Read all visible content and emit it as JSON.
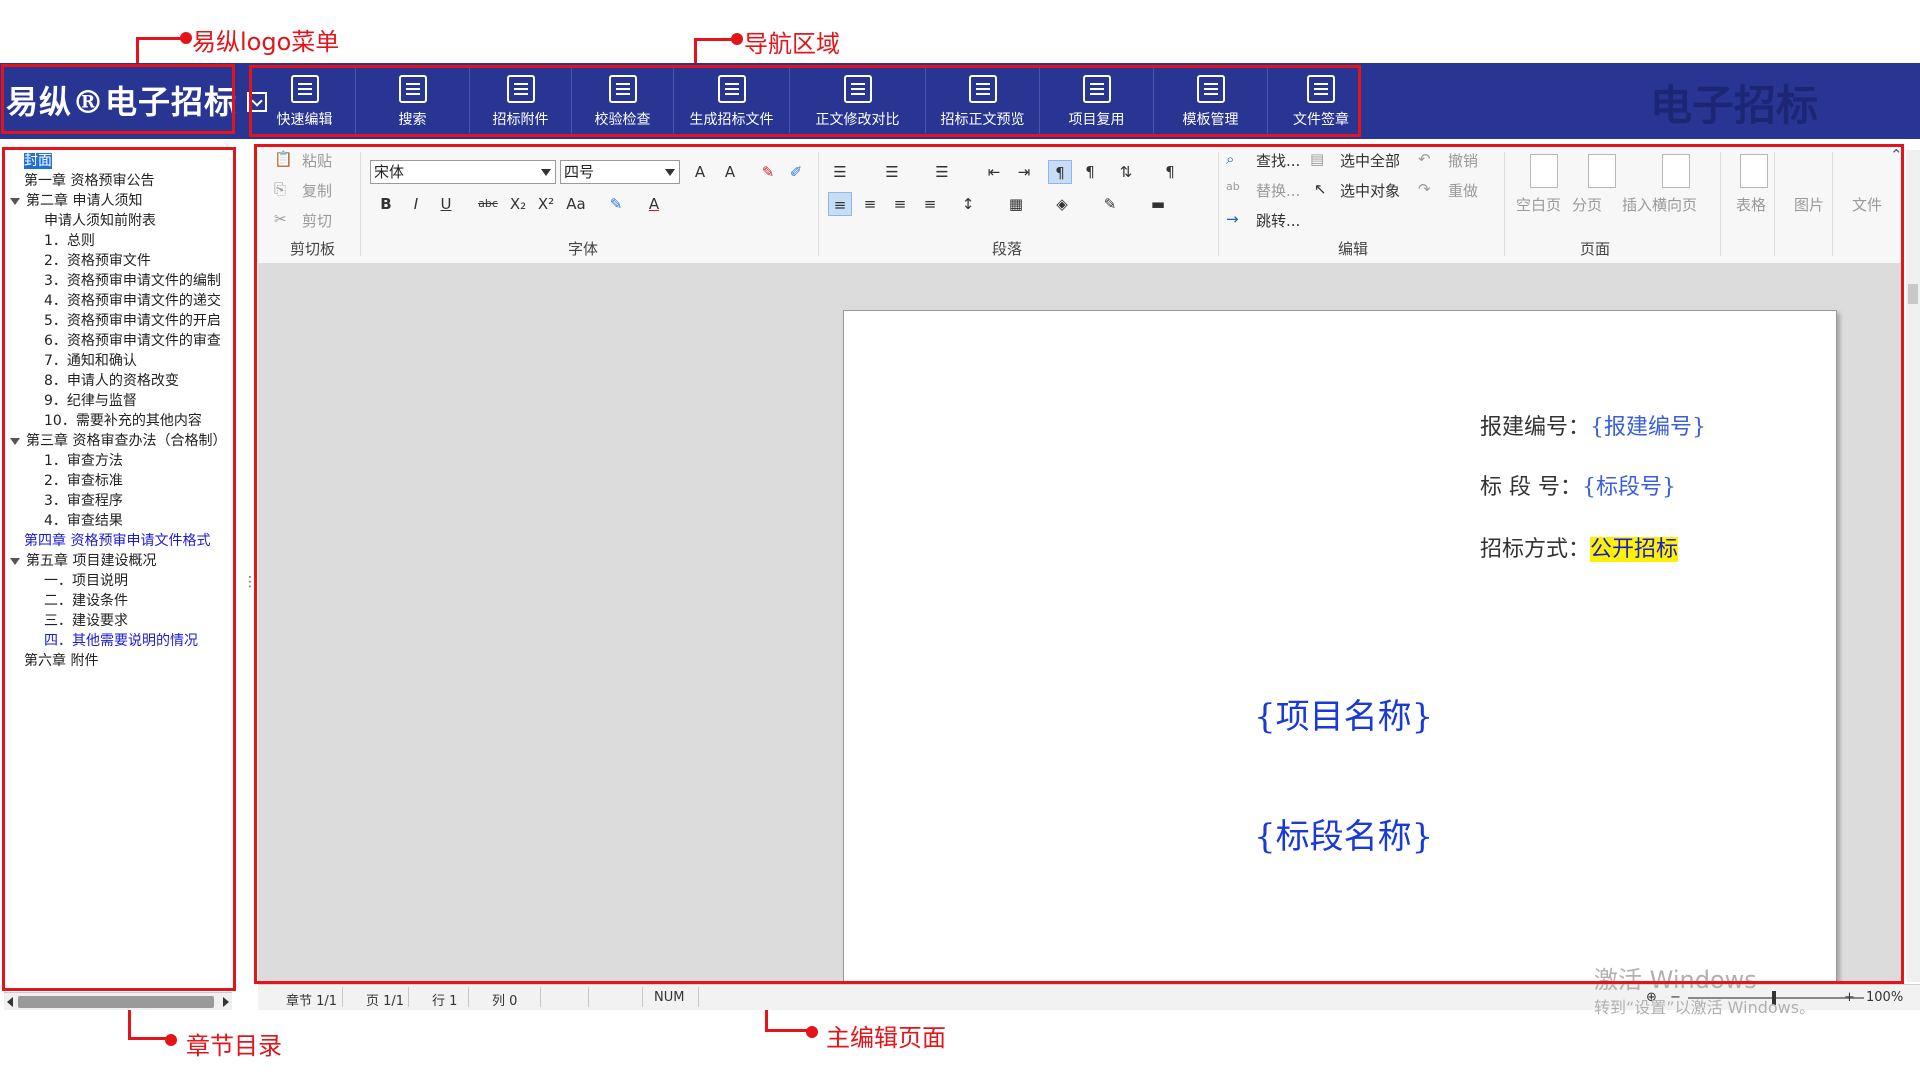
{
  "callouts": {
    "logo_menu": "易纵logo菜单",
    "nav_area": "导航区域",
    "chapter_toc": "章节目录",
    "main_editor": "主编辑页面"
  },
  "header": {
    "brand": "易纵®电子招标",
    "watermark": "电子招标",
    "nav": [
      "快速编辑",
      "搜索",
      "招标附件",
      "校验检查",
      "生成招标文件",
      "正文修改对比",
      "招标正文预览",
      "项目复用",
      "模板管理",
      "文件签章"
    ]
  },
  "toc": {
    "items": [
      {
        "text": "封面",
        "level": 1,
        "selected": true
      },
      {
        "text": "第一章 资格预审公告",
        "level": 1
      },
      {
        "text": "第二章 申请人须知",
        "level": 0
      },
      {
        "text": "申请人须知前附表",
        "level": 2
      },
      {
        "text": "1．总则",
        "level": 2
      },
      {
        "text": "2．资格预审文件",
        "level": 2
      },
      {
        "text": "3．资格预审申请文件的编制",
        "level": 2
      },
      {
        "text": "4．资格预审申请文件的递交",
        "level": 2
      },
      {
        "text": "5．资格预审申请文件的开启",
        "level": 2
      },
      {
        "text": "6．资格预审申请文件的审查",
        "level": 2
      },
      {
        "text": "7．通知和确认",
        "level": 2
      },
      {
        "text": "8．申请人的资格改变",
        "level": 2
      },
      {
        "text": "9．纪律与监督",
        "level": 2
      },
      {
        "text": "10．需要补充的其他内容",
        "level": 2
      },
      {
        "text": "第三章 资格审查办法（合格制）",
        "level": 0
      },
      {
        "text": "1．审查方法",
        "level": 2
      },
      {
        "text": "2．审查标准",
        "level": 2
      },
      {
        "text": "3．审查程序",
        "level": 2
      },
      {
        "text": "4．审查结果",
        "level": 2
      },
      {
        "text": "第四章 资格预审申请文件格式",
        "level": 1,
        "blue": true
      },
      {
        "text": "第五章 项目建设概况",
        "level": 0
      },
      {
        "text": "一．项目说明",
        "level": 2
      },
      {
        "text": "二．建设条件",
        "level": 2
      },
      {
        "text": "三．建设要求",
        "level": 2
      },
      {
        "text": "四．其他需要说明的情况",
        "level": 2,
        "blue": true
      },
      {
        "text": "第六章 附件",
        "level": 1
      }
    ]
  },
  "ribbon": {
    "clipboard": {
      "paste": "粘贴",
      "copy": "复制",
      "cut": "剪切",
      "label": "剪切板"
    },
    "font": {
      "family": "宋体",
      "size": "四号",
      "label": "字体"
    },
    "paragraph": {
      "label": "段落"
    },
    "edit": {
      "find": "查找...",
      "replace": "替换...",
      "goto": "跳转...",
      "select_all": "选中全部",
      "select_object": "选中对象",
      "undo": "撤销",
      "redo": "重做",
      "label": "编辑"
    },
    "page": {
      "blank": "空白页",
      "break": "分页",
      "landscape": "插入横向页",
      "label": "页面"
    },
    "insert": {
      "table": "表格",
      "image": "图片",
      "file": "文件"
    }
  },
  "document": {
    "fields": [
      {
        "label": "报建编号：",
        "value": "{报建编号}"
      },
      {
        "label": "标  段  号：",
        "value": "{标段号}"
      },
      {
        "label": "招标方式：",
        "value": "公开招标",
        "highlight": true
      }
    ],
    "project_name": "{项目名称}",
    "section_name": "{标段名称}"
  },
  "status": {
    "chapter": "章节 1/1",
    "page": "页 1/1",
    "row": "行 1",
    "col": "列 0",
    "num": "NUM",
    "zoom": "100%"
  },
  "windows_watermark": {
    "line1": "激活 Windows",
    "line2": "转到“设置”以激活 Windows。"
  },
  "colors": {
    "header": "#283593",
    "accent": "#e3151b",
    "doc_blue": "#1a3ad6",
    "highlight": "#fff200"
  }
}
